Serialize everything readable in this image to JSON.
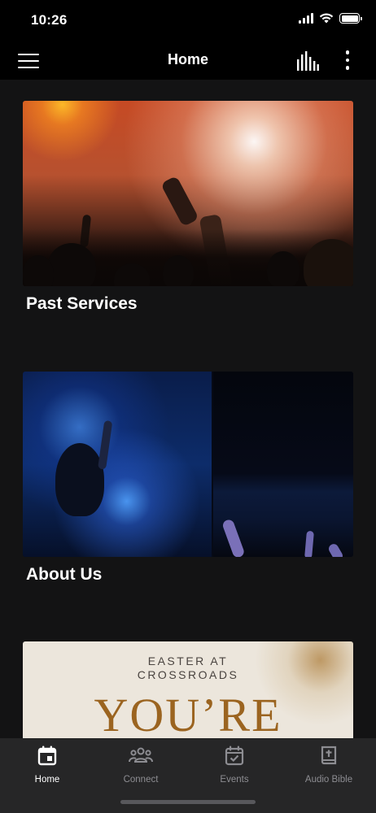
{
  "status_bar": {
    "time": "10:26"
  },
  "nav": {
    "title": "Home",
    "menu_icon": "hamburger-menu-icon",
    "stats_icon": "audio-levels-icon",
    "more_icon": "more-vertical-icon"
  },
  "cards": [
    {
      "title": "Past Services"
    },
    {
      "title": "About Us"
    },
    {
      "title": "",
      "image_text_line1": "EASTER AT",
      "image_text_line2": "CROSSROADS",
      "image_text_big": "YOU’RE"
    }
  ],
  "tabs": [
    {
      "label": "Home",
      "icon": "calendar-home-icon",
      "active": true
    },
    {
      "label": "Connect",
      "icon": "people-icon",
      "active": false
    },
    {
      "label": "Events",
      "icon": "calendar-check-icon",
      "active": false
    },
    {
      "label": "Audio Bible",
      "icon": "bible-icon",
      "active": false
    }
  ],
  "colors": {
    "background": "#131314",
    "bars": "#000000",
    "tab_bar": "#262627",
    "inactive_tab": "#8d8d92"
  }
}
